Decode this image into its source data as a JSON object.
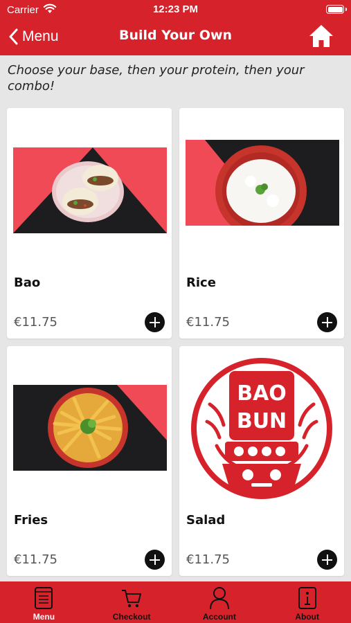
{
  "status": {
    "carrier": "Carrier",
    "time": "12:23 PM"
  },
  "nav": {
    "back_label": "Menu",
    "title": "Build Your Own"
  },
  "subtitle": "Choose your base, then your protein, then your combo!",
  "items": [
    {
      "name": "Bao",
      "price": "€11.75"
    },
    {
      "name": "Rice",
      "price": "€11.75"
    },
    {
      "name": "Fries",
      "price": "€11.75"
    },
    {
      "name": "Salad",
      "price": "€11.75"
    }
  ],
  "logo": {
    "line1": "BAO",
    "line2": "BUN"
  },
  "tabs": [
    {
      "label": "Menu",
      "icon": "menu-book-icon",
      "active": true
    },
    {
      "label": "Checkout",
      "icon": "cart-icon",
      "active": false
    },
    {
      "label": "Account",
      "icon": "person-icon",
      "active": false
    },
    {
      "label": "About",
      "icon": "info-icon",
      "active": false
    }
  ],
  "colors": {
    "brand_red": "#d6232b",
    "background": "#e6e6e6",
    "card": "#ffffff"
  }
}
